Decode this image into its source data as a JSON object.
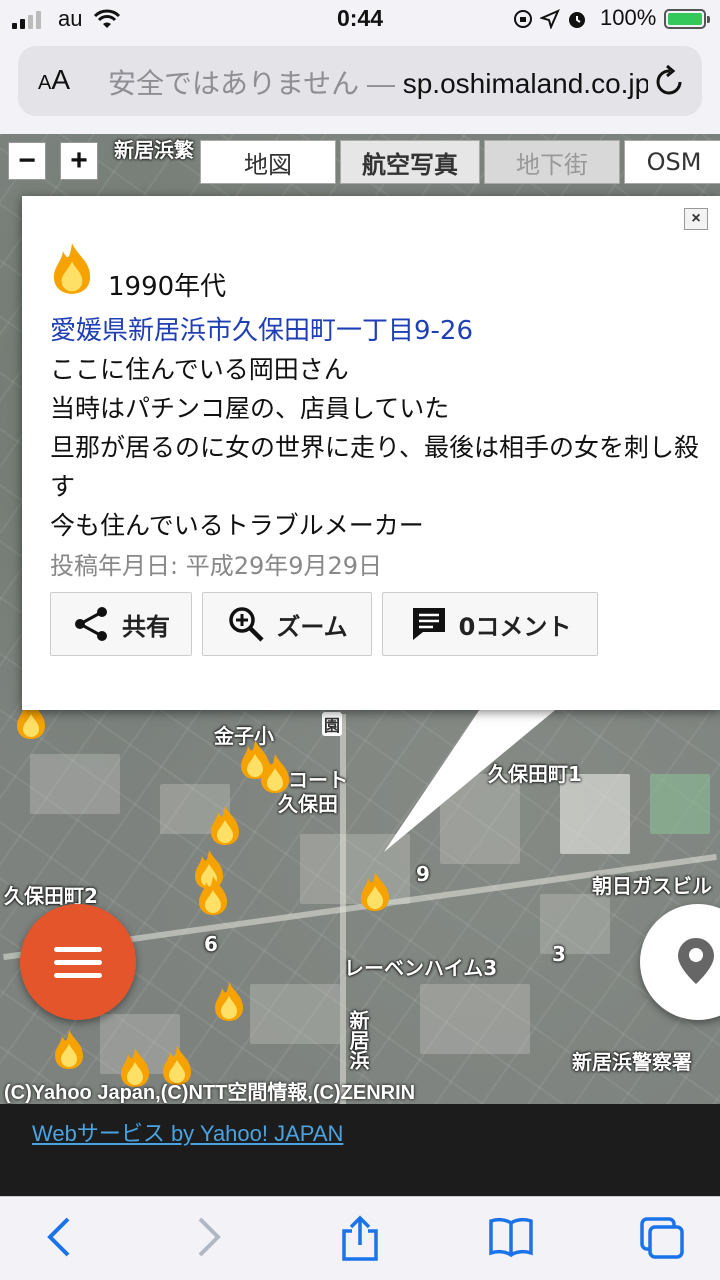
{
  "status_bar": {
    "carrier": "au",
    "time": "0:44",
    "battery_percent": "100%",
    "battery_level": 1.0,
    "icons": [
      "orientation-lock-icon",
      "location-icon",
      "alarm-icon"
    ]
  },
  "browser": {
    "text_size_label_small": "A",
    "text_size_label_large": "A",
    "url_warning": "安全ではありません —",
    "url": "sp.oshimaland.co.jp"
  },
  "map": {
    "zoom_out": "−",
    "zoom_in": "+",
    "tabs": [
      "地図",
      "航空写真",
      "地下街",
      "OSM"
    ],
    "active_tab": "航空写真",
    "labels": {
      "shinhamahama_top": "新居浜繁",
      "kaneko_elementary": "金子小",
      "court_kubota_1": "コート",
      "court_kubota_2": "久保田",
      "kubota_1": "久保田町1",
      "kubota_2": "久保田町2",
      "asahi_gas": "朝日ガスビル",
      "raven_heim": "レーベンハイム3",
      "shinhama_vertical": "新居浜",
      "shinhama_police": "新居浜警察署",
      "num_9": "9",
      "num_6": "6",
      "num_3": "3",
      "garden_mark": "園"
    },
    "copyright": "(C)Yahoo Japan,(C)NTT空間情報,(C)ZENRIN"
  },
  "popup": {
    "close": "×",
    "era": "1990年代",
    "address": "愛媛県新居浜市久保田町一丁目9-26",
    "lines": [
      "ここに住んでいる岡田さん",
      "当時はパチンコ屋の、店員していた",
      "旦那が居るのに女の世界に走り、最後は相手の女を刺し殺す",
      "今も住んでいるトラブルメーカー"
    ],
    "post_date": "投稿年月日: 平成29年9月29日",
    "share_label": "共有",
    "zoom_label": "ズーム",
    "comment_label": "0コメント"
  },
  "footer": {
    "link": "Webサービス by Yahoo! JAPAN"
  },
  "toolbar": {
    "icons": [
      "back-icon",
      "forward-icon",
      "share-icon",
      "bookmarks-icon",
      "tabs-icon"
    ]
  }
}
